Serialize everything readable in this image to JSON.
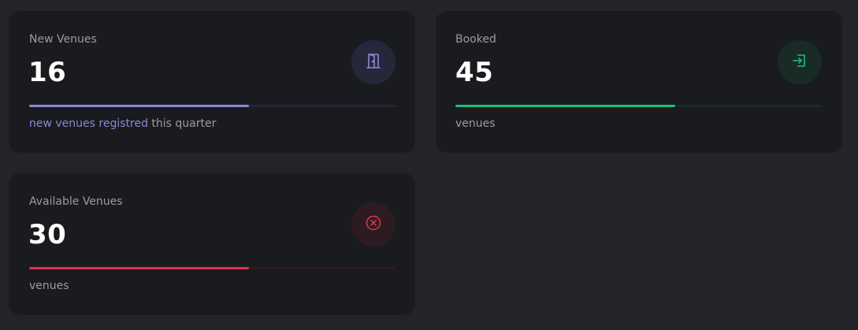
{
  "cards": [
    {
      "label": "New Venues",
      "value": "16",
      "progress_percent": 60,
      "footer_highlight": "new venues registred",
      "footer_text": " this quarter",
      "icon": "door-icon",
      "accent": "#8f86d8",
      "track_color": "#26253a",
      "icon_bg": "#26273a"
    },
    {
      "label": "Booked",
      "value": "45",
      "progress_percent": 60,
      "footer_highlight": "",
      "footer_text": "venues",
      "icon": "sign-in-icon",
      "accent": "#1fbf77",
      "track_color": "#1b2a24",
      "icon_bg": "#182b24"
    },
    {
      "label": "Available Venues",
      "value": "30",
      "progress_percent": 60,
      "footer_highlight": "",
      "footer_text": "venues",
      "icon": "cancel-circle-icon",
      "accent": "#e0334f",
      "track_color": "#2d1b20",
      "icon_bg": "#2c1c21"
    }
  ]
}
